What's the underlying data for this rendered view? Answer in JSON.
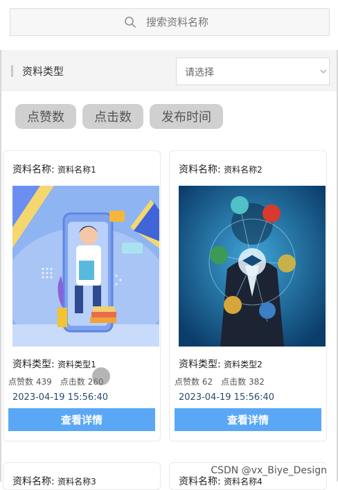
{
  "search": {
    "placeholder": "搜索资料名称",
    "icon": "search-icon"
  },
  "filter": {
    "label": "资料类型",
    "select_value": "请选择",
    "icon": "chevron-down-icon"
  },
  "sort_buttons": [
    "点赞数",
    "点击数",
    "发布时间"
  ],
  "colors": {
    "primary_button": "#5aa8f5",
    "sort_button_bg": "#d0d0d0",
    "filter_bar_bg": "#f4f4f4"
  },
  "cards": [
    {
      "name_label": "资料名称:",
      "name": "资料名称1",
      "type_label": "资料类型:",
      "type": "资料类型1",
      "likes_label": "点赞数",
      "likes": "439",
      "clicks_label": "点击数",
      "clicks": "260",
      "date": "2023-04-19 15:56:40",
      "detail_button": "查看详情",
      "image": "illustration of doctor holding a book inside a phone screen"
    },
    {
      "name_label": "资料名称:",
      "name": "资料名称2",
      "type_label": "资料类型:",
      "type": "资料类型2",
      "likes_label": "点赞数",
      "likes": "62",
      "clicks_label": "点击数",
      "clicks": "382",
      "date": "2023-04-19 15:56:40",
      "detail_button": "查看详情",
      "image": "businessman touching education icons network"
    },
    {
      "name_label": "资料名称:",
      "name": "资料名称3"
    },
    {
      "name_label": "资料名称:",
      "name": "资料名称4"
    }
  ],
  "watermark": "CSDN @vx_Biye_Design"
}
